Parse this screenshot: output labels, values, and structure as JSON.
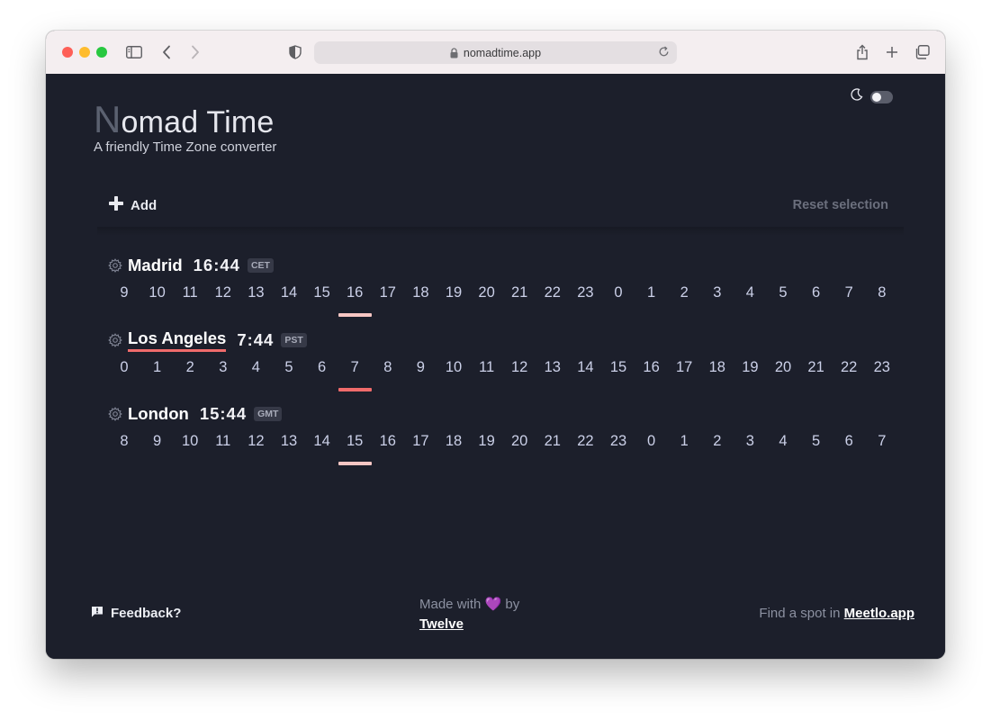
{
  "browser": {
    "url": "nomadtime.app",
    "icons": [
      "sidebar-icon",
      "back-icon",
      "forward-icon",
      "shield-icon",
      "lock-icon",
      "reload-icon",
      "share-icon",
      "new-tab-icon",
      "tabs-overview-icon"
    ]
  },
  "app": {
    "title_initial": "N",
    "title_rest": "omad Time",
    "subtitle": "A friendly Time Zone converter",
    "add_label": "Add",
    "reset_label": "Reset selection",
    "theme_icon": "moon-icon"
  },
  "zones": [
    {
      "city": "Madrid",
      "time": "16:44",
      "abbr": "CET",
      "current_index": 7,
      "hours": [
        "9",
        "10",
        "11",
        "12",
        "13",
        "14",
        "15",
        "16",
        "17",
        "18",
        "19",
        "20",
        "21",
        "22",
        "23",
        "0",
        "1",
        "2",
        "3",
        "4",
        "5",
        "6",
        "7",
        "8"
      ]
    },
    {
      "city": "Los Angeles",
      "time": "7:44",
      "abbr": "PST",
      "current_index": 7,
      "hours": [
        "0",
        "1",
        "2",
        "3",
        "4",
        "5",
        "6",
        "7",
        "8",
        "9",
        "10",
        "11",
        "12",
        "13",
        "14",
        "15",
        "16",
        "17",
        "18",
        "19",
        "20",
        "21",
        "22",
        "23"
      ]
    },
    {
      "city": "London",
      "time": "15:44",
      "abbr": "GMT",
      "current_index": 7,
      "hours": [
        "8",
        "9",
        "10",
        "11",
        "12",
        "13",
        "14",
        "15",
        "16",
        "17",
        "18",
        "19",
        "20",
        "21",
        "22",
        "23",
        "0",
        "1",
        "2",
        "3",
        "4",
        "5",
        "6",
        "7"
      ]
    }
  ],
  "colors": {
    "background": "#1c1f2b",
    "marker_light": "#f7c6c4",
    "marker_accent": "#f06b6b",
    "heart": "#a855f7"
  },
  "footer": {
    "feedback_label": "Feedback?",
    "made_prefix": "Made with",
    "made_heart": "💜",
    "made_suffix": "by",
    "maker": "Twelve",
    "find_spot_prefix": "Find a spot in",
    "find_spot_link": "Meetlo.app"
  }
}
